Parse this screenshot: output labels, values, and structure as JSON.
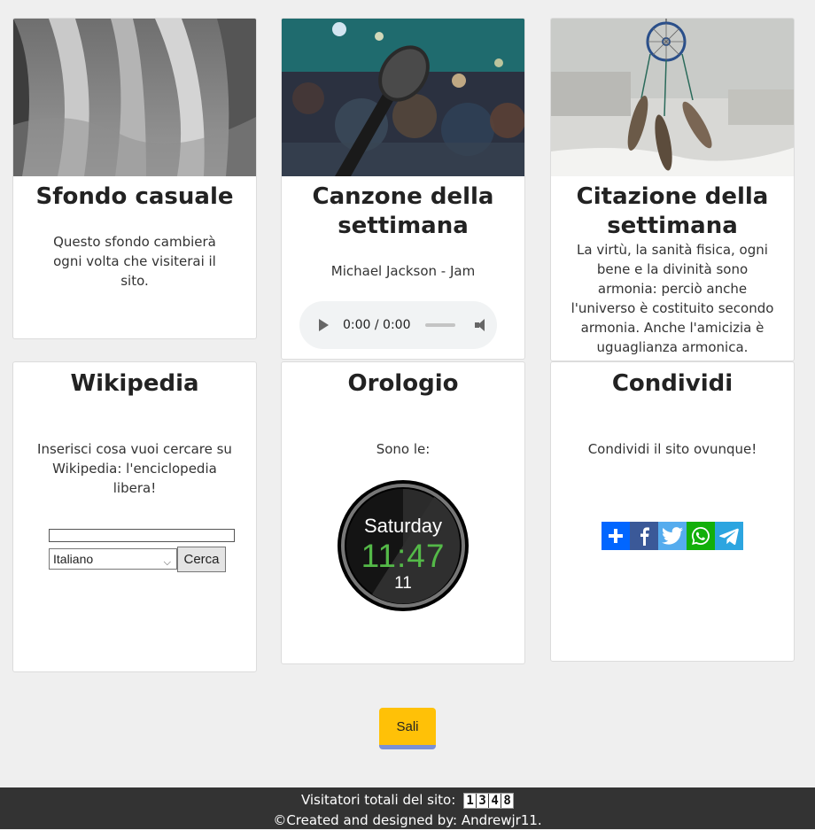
{
  "cards": {
    "sfondo": {
      "title": "Sfondo casuale",
      "text": "Questo sfondo cambierà ogni volta che visiterai il sito."
    },
    "canzone": {
      "title": "Canzone della settimana",
      "song": "Michael Jackson - Jam",
      "player": {
        "time": "0:00 / 0:00"
      }
    },
    "citazione": {
      "title": "Citazione della settimana",
      "quote": "La virtù, la sanità fisica, ogni bene e la divinità sono armonia: perciò anche l'universo è costituito secondo armonia. Anche l'amicizia è uguaglianza armonica. (Pitagora)"
    },
    "wikipedia": {
      "title": "Wikipedia",
      "text": "Inserisci cosa vuoi cercare su Wikipedia: l'enciclopedia libera!",
      "search_value": "",
      "language_selected": "Italiano",
      "button": "Cerca"
    },
    "orologio": {
      "title": "Orologio",
      "text": "Sono le:",
      "day": "Saturday",
      "time": "11:47",
      "date": "11",
      "time_color": "#54b948"
    },
    "condividi": {
      "title": "Condividi",
      "text": "Condividi il sito ovunque!",
      "buttons": [
        {
          "icon": "plus-icon",
          "color": "#0166ff"
        },
        {
          "icon": "facebook-icon",
          "color": "#3b5998"
        },
        {
          "icon": "twitter-icon",
          "color": "#55acee"
        },
        {
          "icon": "whatsapp-icon",
          "color": "#12af0a"
        },
        {
          "icon": "telegram-icon",
          "color": "#2ca5e0"
        }
      ]
    }
  },
  "scroll_up": {
    "label": "Sali",
    "color": "#ffc107"
  },
  "footer": {
    "visitors_label": "Visitatori totali del sito:",
    "visitor_count": [
      "1",
      "3",
      "4",
      "8"
    ],
    "credits": "©Created and designed by: Andrewjr11."
  }
}
